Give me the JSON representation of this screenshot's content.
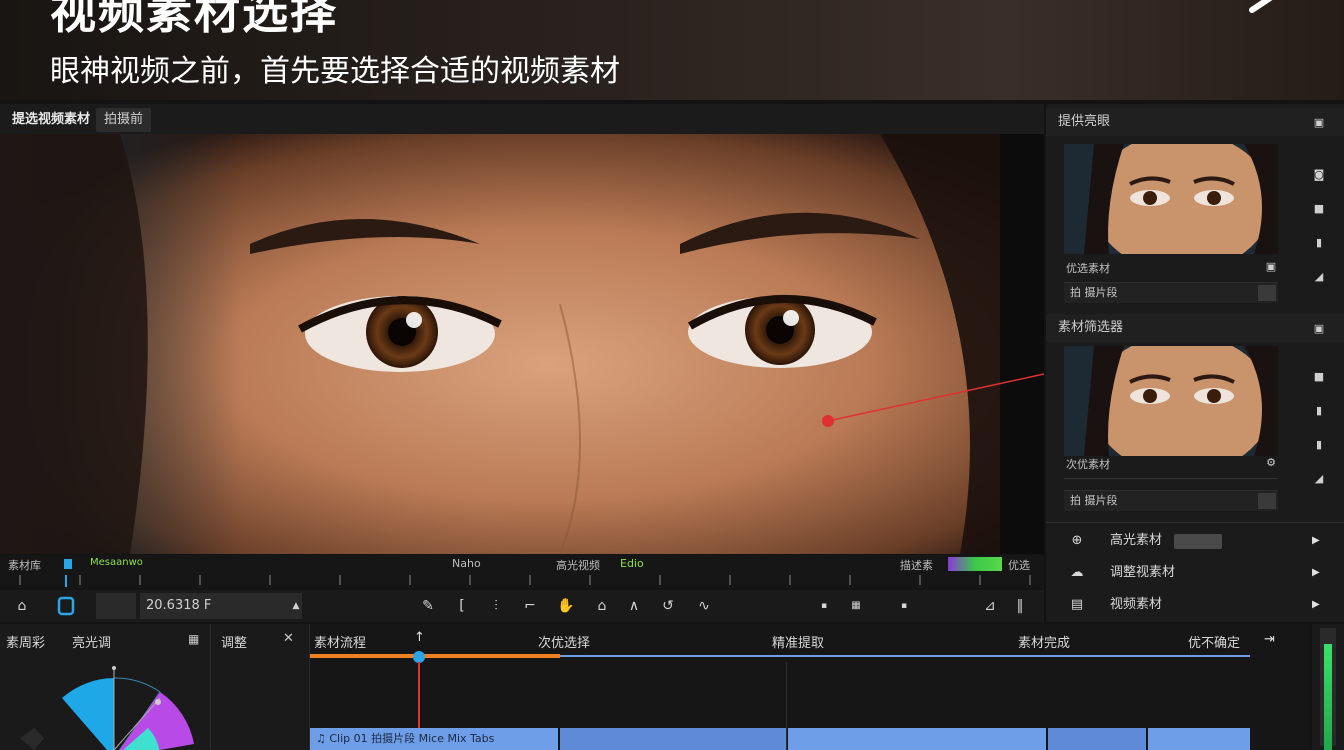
{
  "banner": {
    "title": "视频素材选择",
    "subtitle": "眼神视频之前，首先要选择合适的视频素材"
  },
  "tabs": [
    {
      "label": "提选视频素材"
    },
    {
      "label": "拍摄前"
    }
  ],
  "ruler": {
    "left_label": "素材库",
    "markers": [
      "Naho",
      "高光视频",
      "Edio",
      "描述素"
    ],
    "green_label": "Mesaanwo",
    "end_label": "优选"
  },
  "controls": {
    "timecode": "20.6318 F"
  },
  "right_panel": {
    "header1": "提供亮眼",
    "thumb1_label": "优选素材",
    "thumb1_meta": "拍 摄片段",
    "header2": "素材筛选器",
    "thumb2_label": "次优素材",
    "thumb2_meta": "拍 摄片段",
    "menu": [
      {
        "icon": "filter-icon",
        "label": "高光素材"
      },
      {
        "icon": "palette-icon",
        "label": "调整视素材"
      },
      {
        "icon": "film-icon",
        "label": "视频素材"
      }
    ]
  },
  "bottom": {
    "color_panel": {
      "label_a": "素周彩",
      "label_b": "亮光调"
    },
    "props_panel": {
      "label": "调整"
    },
    "timeline": {
      "labels": [
        "素材流程",
        "次优选择",
        "精准提取",
        "素材完成",
        "优不确定"
      ],
      "clip_text": "♫ Clip 01  拍摄片段  Mice  Mix  Tabs"
    }
  },
  "colors": {
    "playhead": "#2aa6e8",
    "accent_orange": "#f08020",
    "clip_blue": "#6f9ee8",
    "pointer_red": "#e03030"
  }
}
